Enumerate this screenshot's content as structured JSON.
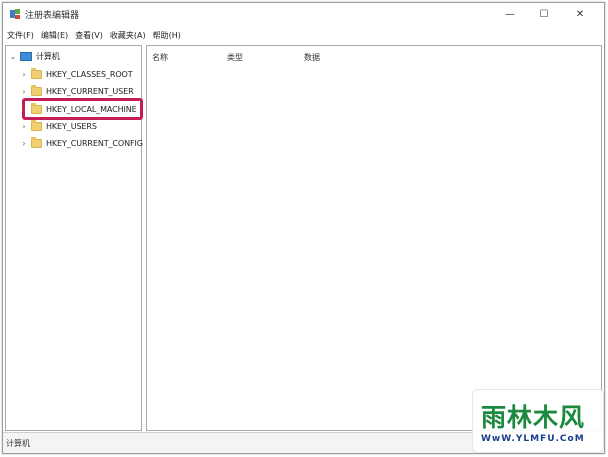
{
  "window": {
    "title": "注册表编辑器",
    "controls": {
      "minimize": "—",
      "maximize": "☐",
      "close": "✕"
    }
  },
  "menu": [
    "文件(F)",
    "编辑(E)",
    "查看(V)",
    "收藏夹(A)",
    "帮助(H)"
  ],
  "tree": {
    "root": "计算机",
    "items": [
      "HKEY_CLASSES_ROOT",
      "HKEY_CURRENT_USER",
      "HKEY_LOCAL_MACHINE",
      "HKEY_USERS",
      "HKEY_CURRENT_CONFIG"
    ]
  },
  "columns": {
    "name": "名称",
    "type": "类型",
    "data": "数据"
  },
  "status": "计算机",
  "watermark": {
    "logo": "雨林木风",
    "url": "WwW.YLMFU.CoM"
  },
  "colors": {
    "highlight": "#c41e56",
    "folder": "#f0cf73"
  }
}
